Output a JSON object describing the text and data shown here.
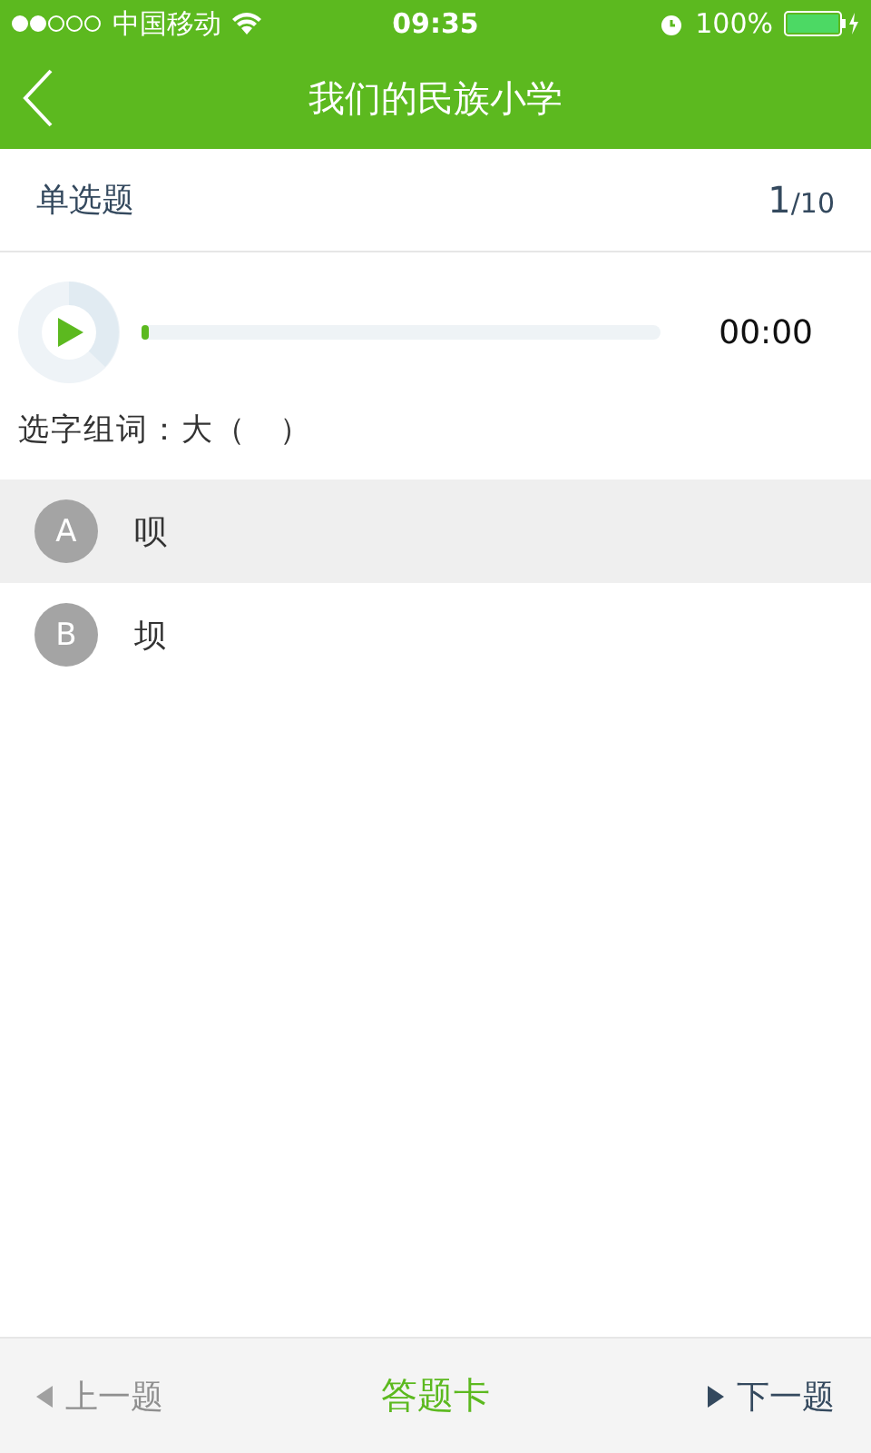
{
  "status_bar": {
    "carrier": "中国移动",
    "time": "09:35",
    "battery": "100%"
  },
  "nav": {
    "title": "我们的民族小学"
  },
  "header": {
    "type": "单选题",
    "current": "1",
    "total": "/10"
  },
  "player": {
    "level": 0,
    "time": "00:00"
  },
  "question": "选字组词：大（　）",
  "options": [
    {
      "letter": "A",
      "text": "呗",
      "selected": true
    },
    {
      "letter": "B",
      "text": "坝",
      "selected": false
    }
  ],
  "footer": {
    "prev": {
      "label": "上一题",
      "disabled": true
    },
    "card": "答题卡",
    "next": {
      "label": "下一题",
      "disabled": false
    }
  }
}
